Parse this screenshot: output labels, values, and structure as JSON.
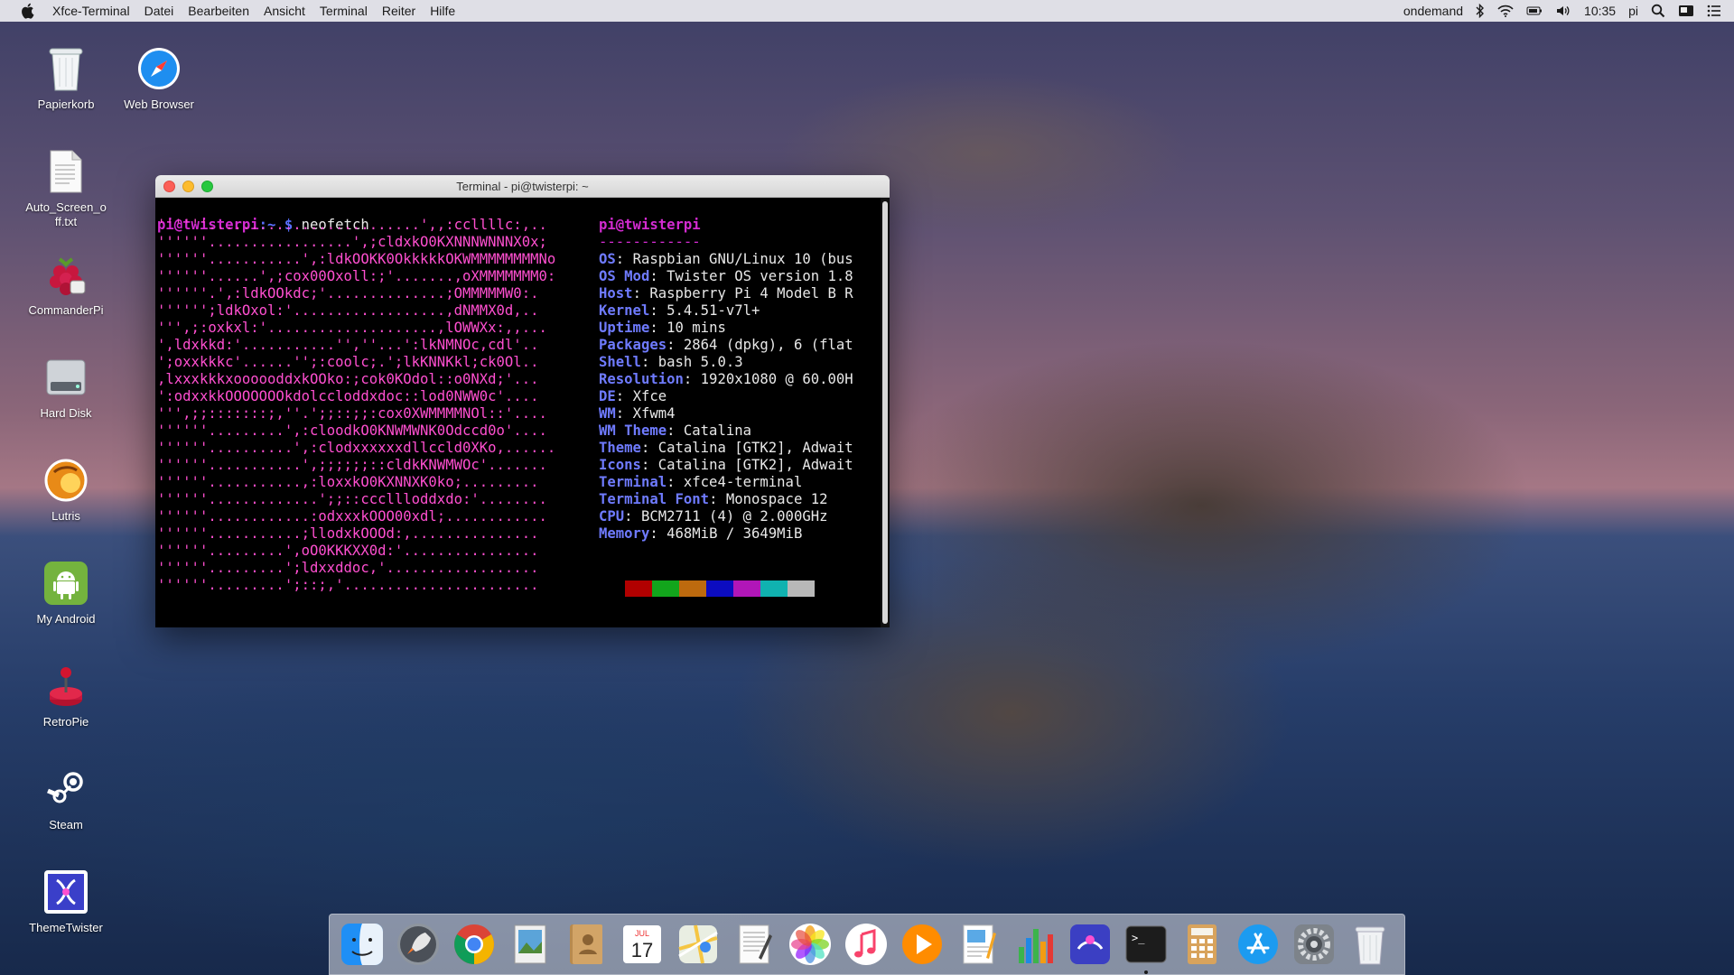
{
  "menubar": {
    "app_name": "Xfce-Terminal",
    "items": [
      "Datei",
      "Bearbeiten",
      "Ansicht",
      "Terminal",
      "Reiter",
      "Hilfe"
    ],
    "cpu_governor": "ondemand",
    "time": "10:35",
    "user": "pi"
  },
  "desktop": {
    "icons": [
      {
        "label": "Papierkorb",
        "icon": "trash-icon"
      },
      {
        "label": "Web Browser",
        "icon": "safari-compass-icon"
      },
      {
        "label": "Auto_Screen_off.txt",
        "icon": "text-file-icon"
      },
      {
        "label": "CommanderPi",
        "icon": "raspberry-icon"
      },
      {
        "label": "Hard Disk",
        "icon": "hard-disk-icon"
      },
      {
        "label": "Lutris",
        "icon": "lutris-icon"
      },
      {
        "label": "My Android",
        "icon": "android-icon"
      },
      {
        "label": "RetroPie",
        "icon": "joystick-icon"
      },
      {
        "label": "Steam",
        "icon": "steam-icon"
      },
      {
        "label": "ThemeTwister",
        "icon": "themetwister-icon"
      }
    ]
  },
  "terminal": {
    "title": "Terminal - pi@twisterpi: ~",
    "prompt_user": "pi@twisterpi",
    "prompt_path": ":~",
    "prompt_symbol": "$",
    "command": "neofetch",
    "ascii_art": [
      "''''''.........................',,:ccllllc:,..",
      "''''''.................',;cldxkO0KXNNNWNNNX0x;",
      "''''''...........',:ldkOOKK0OkkkkkOKWMMMMMMMMNo",
      "''''''......',;cox00Oxoll:;'.......,oXMMMMMMM0:",
      "''''''.',:ldkOOkdc;'..............;OMMMMMW0:.",
      "'''''';ldkOxol:'..................,dNMMX0d,..",
      "''',;:oxkxl:'....................,lOWWXx:,,...",
      "',ldxkkd:'...........'',''...':lkNMNOc,cdl'..",
      "';oxxkkkc'......'';:coolc;.';lkKNNKkl;ck0Ol..",
      ",lxxxkkkxoooooddxkOOko:;cok0KOdol::o0NXd;'...",
      "':odxxkkOOOOOOOkdolccloddxdoc::lod0NWW0c'....",
      "''',;;:::::::;,''.';;::;;:cox0XWMMMMNOl::'....",
      "''''''.........',:cloodkO0KNWMWNK0Odccd0o'....",
      "''''''..........',:clodxxxxxxdllccld0XKo,......",
      "''''''...........',;;;;;;::cldkKNWMWOc'.......",
      "''''''...........,:loxxkO0KXNNXK0ko;.........",
      "''''''.............';;::cccllloddxdo:'........",
      "''''''............:odxxxkOOO00xdl;............",
      "''''''...........;llodxkOOOd:,...............",
      "''''''.........',oO0KKKXX0d:'................",
      "''''''.........';ldxxddoc,'..................",
      "''''''.........';::;,'......................."
    ],
    "info_header": "pi@twisterpi",
    "info_separator": "------------",
    "info": [
      {
        "key": "OS",
        "value": "Raspbian GNU/Linux 10 (bus"
      },
      {
        "key": "OS Mod",
        "value": "Twister OS version 1.8"
      },
      {
        "key": "Host",
        "value": "Raspberry Pi 4 Model B R"
      },
      {
        "key": "Kernel",
        "value": "5.4.51-v7l+"
      },
      {
        "key": "Uptime",
        "value": "10 mins"
      },
      {
        "key": "Packages",
        "value": "2864 (dpkg), 6 (flat"
      },
      {
        "key": "Shell",
        "value": "bash 5.0.3"
      },
      {
        "key": "Resolution",
        "value": "1920x1080 @ 60.00H"
      },
      {
        "key": "DE",
        "value": "Xfce"
      },
      {
        "key": "WM",
        "value": "Xfwm4"
      },
      {
        "key": "WM Theme",
        "value": "Catalina"
      },
      {
        "key": "Theme",
        "value": "Catalina [GTK2], Adwait"
      },
      {
        "key": "Icons",
        "value": "Catalina [GTK2], Adwait"
      },
      {
        "key": "Terminal",
        "value": "xfce4-terminal"
      },
      {
        "key": "Terminal Font",
        "value": "Monospace 12"
      },
      {
        "key": "CPU",
        "value": "BCM2711 (4) @ 2.000GHz"
      },
      {
        "key": "Memory",
        "value": "468MiB / 3649MiB"
      }
    ],
    "color_swatches": [
      "#b10000",
      "#12a51c",
      "#bd6a0e",
      "#0c0cc0",
      "#b116b8",
      "#10b2b0",
      "#b8b8b8"
    ]
  },
  "dock": {
    "items": [
      {
        "name": "finder",
        "icon": "finder-icon"
      },
      {
        "name": "launchpad",
        "icon": "rocket-icon"
      },
      {
        "name": "chrome",
        "icon": "chrome-icon"
      },
      {
        "name": "preview",
        "icon": "preview-icon"
      },
      {
        "name": "contacts",
        "icon": "contacts-icon"
      },
      {
        "name": "calendar",
        "icon": "calendar-icon",
        "text_month": "JUL",
        "text_day": "17"
      },
      {
        "name": "maps",
        "icon": "maps-icon"
      },
      {
        "name": "textedit",
        "icon": "textedit-icon"
      },
      {
        "name": "photos",
        "icon": "photos-icon"
      },
      {
        "name": "music",
        "icon": "music-icon"
      },
      {
        "name": "vlc",
        "icon": "play-icon"
      },
      {
        "name": "pages",
        "icon": "pages-icon"
      },
      {
        "name": "numbers",
        "icon": "numbers-icon"
      },
      {
        "name": "themetwister",
        "icon": "themetwister-dock-icon"
      },
      {
        "name": "terminal",
        "icon": "terminal-icon",
        "terminal_text": ">_",
        "active": true
      },
      {
        "name": "calculator",
        "icon": "calculator-icon"
      },
      {
        "name": "app-store",
        "icon": "app-store-icon"
      },
      {
        "name": "system-preferences",
        "icon": "gear-icon"
      },
      {
        "name": "trash",
        "icon": "trash-dock-icon"
      }
    ]
  }
}
